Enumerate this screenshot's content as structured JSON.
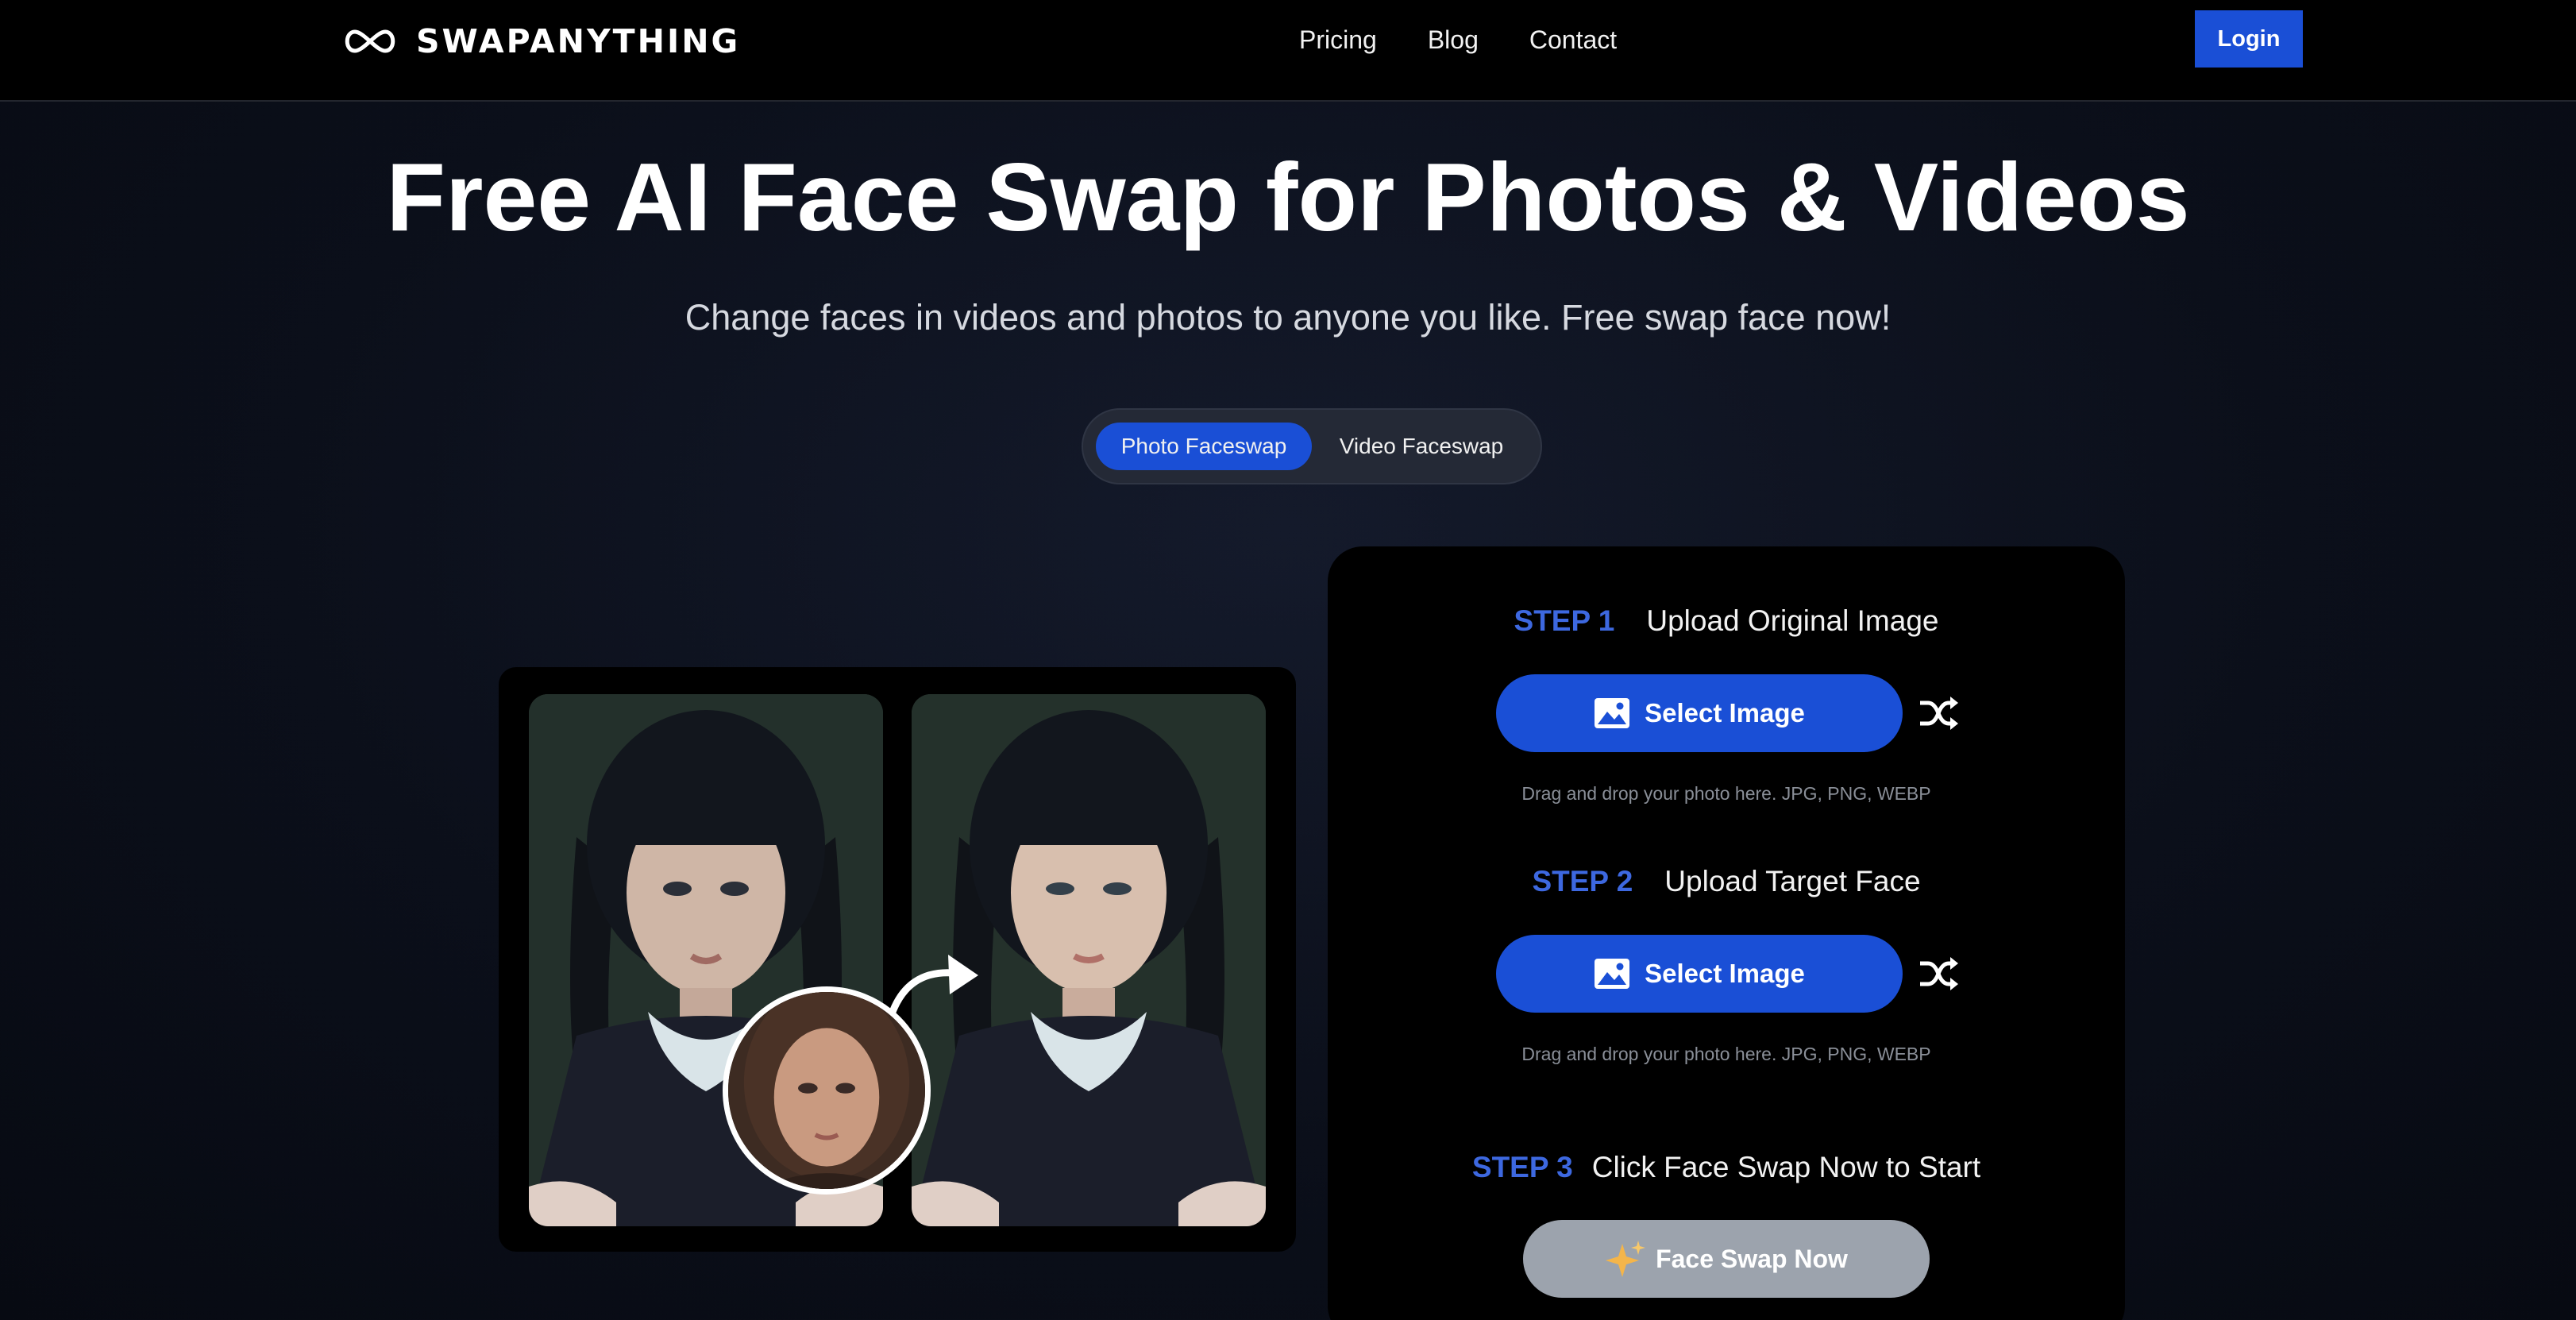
{
  "header": {
    "logo_text": "SWAPANYTHING",
    "nav": [
      "Pricing",
      "Blog",
      "Contact"
    ],
    "login_label": "Login"
  },
  "hero": {
    "title": "Free AI Face Swap for Photos & Videos",
    "subtitle": "Change faces in videos and photos to anyone you like. Free swap face now!"
  },
  "mode_toggle": {
    "options": [
      "Photo Faceswap",
      "Video Faceswap"
    ],
    "selected": "Photo Faceswap"
  },
  "steps": [
    {
      "label": "STEP 1",
      "text": "Upload Original Image",
      "button": "Select Image",
      "hint": "Drag and drop your photo here. JPG, PNG, WEBP"
    },
    {
      "label": "STEP 2",
      "text": "Upload Target Face",
      "button": "Select Image",
      "hint": "Drag and drop your photo here. JPG, PNG, WEBP"
    },
    {
      "label": "STEP 3",
      "text": "Click Face Swap Now to Start",
      "button": "Face Swap Now"
    }
  ],
  "colors": {
    "accent": "#1a4fd6",
    "step_label": "#3d68e0",
    "disabled_button": "#9ca3ad",
    "background": "#0b0f1a"
  },
  "icons": [
    "infinity-logo-icon",
    "image-icon",
    "shuffle-icon",
    "sparkle-icon",
    "curved-arrow-icon"
  ]
}
